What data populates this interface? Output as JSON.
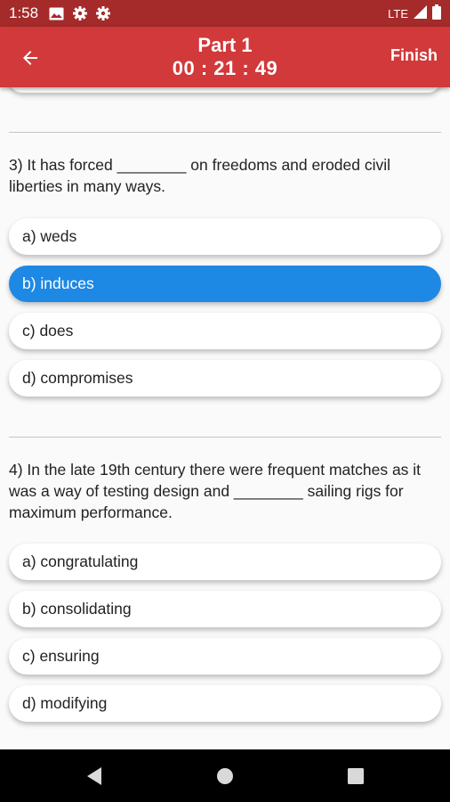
{
  "status_bar": {
    "time": "1:58",
    "network": "LTE"
  },
  "app_bar": {
    "title": "Part 1",
    "timer": "00 : 21 : 49",
    "finish_label": "Finish"
  },
  "questions": [
    {
      "number": "3)",
      "text": "3)  It has forced ________ on freedoms and eroded civil liberties in many ways.",
      "options": [
        {
          "label": "a) weds",
          "selected": false
        },
        {
          "label": "b) induces",
          "selected": true
        },
        {
          "label": "c) does",
          "selected": false
        },
        {
          "label": "d) compromises",
          "selected": false
        }
      ]
    },
    {
      "number": "4)",
      "text": "4)  In the late 19th century there were frequent matches as it was a way of testing design and ________ sailing rigs for maximum performance.",
      "options": [
        {
          "label": "a) congratulating",
          "selected": false
        },
        {
          "label": "b) consolidating",
          "selected": false
        },
        {
          "label": "c) ensuring",
          "selected": false
        },
        {
          "label": "d) modifying",
          "selected": false
        }
      ]
    }
  ],
  "colors": {
    "status_bar": "#a52a2a",
    "app_bar": "#d1393a",
    "selected_option": "#1e88e5",
    "background": "#fafafa"
  },
  "icons": {
    "back": "arrow-left-icon",
    "gallery": "image-icon",
    "settings": "gear-icon",
    "signal": "signal-icon",
    "battery": "battery-icon",
    "nav_back": "triangle-back-icon",
    "nav_home": "circle-home-icon",
    "nav_recents": "square-recents-icon"
  }
}
